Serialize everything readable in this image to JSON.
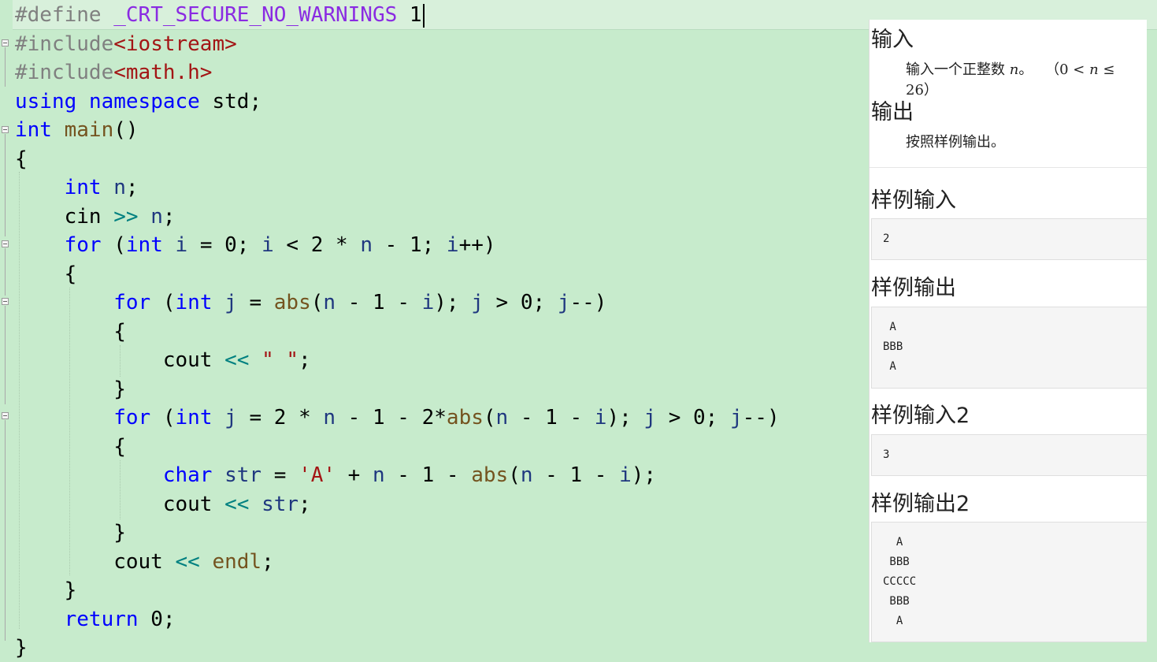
{
  "editor": {
    "lines": [
      [
        [
          "pp",
          "#define "
        ],
        [
          "mac",
          "_CRT_SECURE_NO_WARNINGS"
        ],
        [
          "pp",
          " "
        ],
        [
          "",
          "1"
        ]
      ],
      [
        [
          "pp",
          "#include"
        ],
        [
          "str",
          "<iostream>"
        ]
      ],
      [
        [
          "pp",
          "#include"
        ],
        [
          "str",
          "<math.h>"
        ]
      ],
      [
        [
          "kw",
          "using"
        ],
        [
          "",
          " "
        ],
        [
          "kw",
          "namespace"
        ],
        [
          "",
          " std;"
        ]
      ],
      [
        [
          "kw",
          "int"
        ],
        [
          "",
          " "
        ],
        [
          "fn",
          "main"
        ],
        [
          "",
          "()"
        ]
      ],
      [
        [
          "",
          "{"
        ]
      ],
      [
        [
          "",
          "    "
        ],
        [
          "kw",
          "int"
        ],
        [
          "",
          " "
        ],
        [
          "var",
          "n"
        ],
        [
          "",
          ";"
        ]
      ],
      [
        [
          "",
          "    cin "
        ],
        [
          "op",
          ">>"
        ],
        [
          "",
          " "
        ],
        [
          "var",
          "n"
        ],
        [
          "",
          ";"
        ]
      ],
      [
        [
          "",
          "    "
        ],
        [
          "kw",
          "for"
        ],
        [
          "",
          " ("
        ],
        [
          "kw",
          "int"
        ],
        [
          "",
          " "
        ],
        [
          "var",
          "i"
        ],
        [
          "",
          " = 0; "
        ],
        [
          "var",
          "i"
        ],
        [
          "",
          " < 2 * "
        ],
        [
          "var",
          "n"
        ],
        [
          "",
          " - 1; "
        ],
        [
          "var",
          "i"
        ],
        [
          "",
          "++)"
        ]
      ],
      [
        [
          "",
          "    {"
        ]
      ],
      [
        [
          "",
          "        "
        ],
        [
          "kw",
          "for"
        ],
        [
          "",
          " ("
        ],
        [
          "kw",
          "int"
        ],
        [
          "",
          " "
        ],
        [
          "var",
          "j"
        ],
        [
          "",
          " = "
        ],
        [
          "fn",
          "abs"
        ],
        [
          "",
          "("
        ],
        [
          "var",
          "n"
        ],
        [
          "",
          " - 1 - "
        ],
        [
          "var",
          "i"
        ],
        [
          "",
          "); "
        ],
        [
          "var",
          "j"
        ],
        [
          "",
          " > 0; "
        ],
        [
          "var",
          "j"
        ],
        [
          "",
          "--)"
        ]
      ],
      [
        [
          "",
          "        {"
        ]
      ],
      [
        [
          "",
          "            cout "
        ],
        [
          "op",
          "<<"
        ],
        [
          "",
          " "
        ],
        [
          "str",
          "\" \""
        ],
        [
          "",
          ";"
        ]
      ],
      [
        [
          "",
          "        }"
        ]
      ],
      [
        [
          "",
          "        "
        ],
        [
          "kw",
          "for"
        ],
        [
          "",
          " ("
        ],
        [
          "kw",
          "int"
        ],
        [
          "",
          " "
        ],
        [
          "var",
          "j"
        ],
        [
          "",
          " = 2 * "
        ],
        [
          "var",
          "n"
        ],
        [
          "",
          " - 1 - 2*"
        ],
        [
          "fn",
          "abs"
        ],
        [
          "",
          "("
        ],
        [
          "var",
          "n"
        ],
        [
          "",
          " - 1 - "
        ],
        [
          "var",
          "i"
        ],
        [
          "",
          "); "
        ],
        [
          "var",
          "j"
        ],
        [
          "",
          " > 0; "
        ],
        [
          "var",
          "j"
        ],
        [
          "",
          "--)"
        ]
      ],
      [
        [
          "",
          "        {"
        ]
      ],
      [
        [
          "",
          "            "
        ],
        [
          "kw",
          "char"
        ],
        [
          "",
          " "
        ],
        [
          "var",
          "str"
        ],
        [
          "",
          " = "
        ],
        [
          "str",
          "'A'"
        ],
        [
          "",
          " + "
        ],
        [
          "var",
          "n"
        ],
        [
          "",
          " - 1 - "
        ],
        [
          "fn",
          "abs"
        ],
        [
          "",
          "("
        ],
        [
          "var",
          "n"
        ],
        [
          "",
          " - 1 - "
        ],
        [
          "var",
          "i"
        ],
        [
          "",
          ");"
        ]
      ],
      [
        [
          "",
          "            cout "
        ],
        [
          "op",
          "<<"
        ],
        [
          "",
          " "
        ],
        [
          "var",
          "str"
        ],
        [
          "",
          ";"
        ]
      ],
      [
        [
          "",
          "        }"
        ]
      ],
      [
        [
          "",
          "        cout "
        ],
        [
          "op",
          "<<"
        ],
        [
          "",
          " "
        ],
        [
          "fn",
          "endl"
        ],
        [
          "",
          ";"
        ]
      ],
      [
        [
          "",
          "    }"
        ]
      ],
      [
        [
          "",
          "    "
        ],
        [
          "kw",
          "return"
        ],
        [
          "",
          " 0;"
        ]
      ],
      [
        [
          "",
          "}"
        ]
      ]
    ]
  },
  "panel": {
    "input_heading": "输入",
    "input_desc": "输入一个正整数",
    "input_var": "n",
    "input_period": "。",
    "constraint_open": "（",
    "constraint_lo": "0 <",
    "constraint_var": "n",
    "constraint_hi": "≤ 26",
    "constraint_close": "）",
    "output_heading": "输出",
    "output_desc": "按照样例输出。",
    "sample_input_heading": "样例输入",
    "sample_input": "2",
    "sample_output_heading": "样例输出",
    "sample_output": " A\nBBB\n A",
    "sample_input2_heading": "样例输入2",
    "sample_input2": "3",
    "sample_output2_heading": "样例输出2",
    "sample_output2": "  A\n BBB\nCCCCC\n BBB\n  A"
  },
  "colors": {
    "editor_background": "#c7ebcc",
    "keyword": "#0000ff",
    "string": "#a31515",
    "macro": "#8a2be2",
    "function": "#74531f",
    "variable": "#1f377f",
    "operator": "#008080",
    "preprocessor": "#808080"
  }
}
